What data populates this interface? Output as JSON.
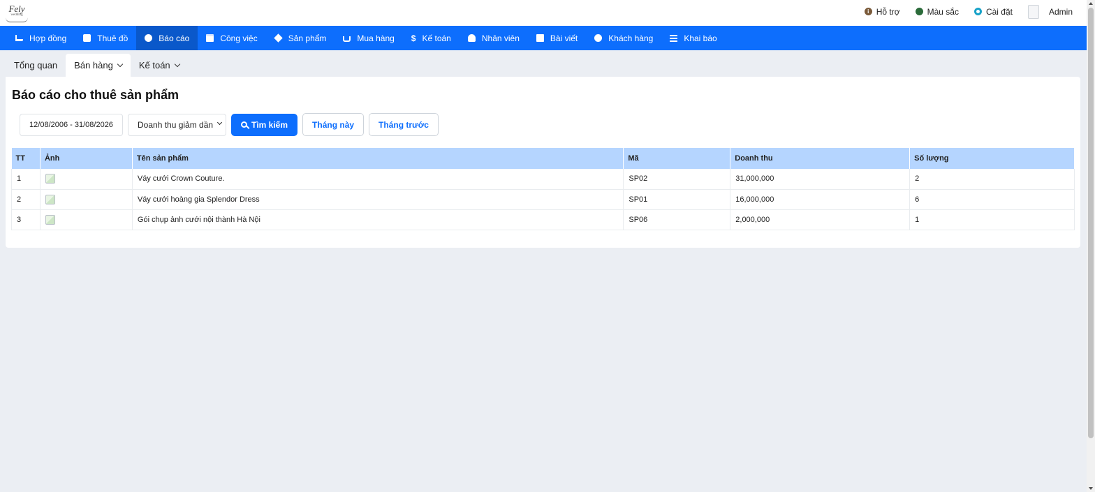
{
  "logo": {
    "text": "Fely",
    "sub": "wedding"
  },
  "topbar": {
    "support": "Hỗ trợ",
    "colors": "Màu sắc",
    "settings": "Cài đặt",
    "user": "Admin"
  },
  "nav": {
    "items": [
      {
        "label": "Hợp đồng",
        "icon": "cart-icon"
      },
      {
        "label": "Thuê đồ",
        "icon": "bootstrap-b-icon"
      },
      {
        "label": "Báo cáo",
        "icon": "chart-pie-icon",
        "active": true
      },
      {
        "label": "Công việc",
        "icon": "calendar-icon"
      },
      {
        "label": "Sản phẩm",
        "icon": "box-icon"
      },
      {
        "label": "Mua hàng",
        "icon": "basket-icon"
      },
      {
        "label": "Kế toán",
        "icon": "dollar-icon"
      },
      {
        "label": "Nhân viên",
        "icon": "user-icon"
      },
      {
        "label": "Bài viết",
        "icon": "newspaper-icon"
      },
      {
        "label": "Khách hàng",
        "icon": "smile-icon"
      },
      {
        "label": "Khai báo",
        "icon": "list-icon"
      }
    ]
  },
  "subnav": {
    "overview": "Tổng quan",
    "sales": "Bán hàng",
    "accounting": "Kế toán"
  },
  "page": {
    "title": "Báo cáo cho thuê sản phẩm"
  },
  "filters": {
    "date_range": "12/08/2006 - 31/08/2026",
    "sort_selected": "Doanh thu giảm dần",
    "search_label": "Tìm kiếm",
    "this_month_label": "Tháng này",
    "last_month_label": "Tháng trước"
  },
  "table": {
    "headers": [
      "TT",
      "Ảnh",
      "Tên sản phẩm",
      "Mã",
      "Doanh thu",
      "Số lượng"
    ],
    "rows": [
      {
        "tt": "1",
        "name": "Váy cưới Crown Couture.",
        "code": "SP02",
        "revenue": "31,000,000",
        "qty": "2"
      },
      {
        "tt": "2",
        "name": "Váy cưới hoàng gia Splendor Dress",
        "code": "SP01",
        "revenue": "16,000,000",
        "qty": "6"
      },
      {
        "tt": "3",
        "name": "Gói chụp ảnh cưới nội thành Hà Nội",
        "code": "SP06",
        "revenue": "2,000,000",
        "qty": "1"
      }
    ]
  },
  "colors": {
    "primary": "#0d6efd",
    "nav_active": "#0a58ca",
    "table_header": "#b5d5ff",
    "background": "#ebeef3"
  }
}
